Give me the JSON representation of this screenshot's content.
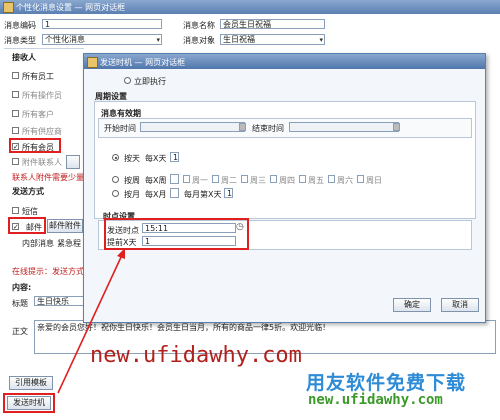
{
  "back_window": {
    "title": "个性化消息设置 — 网页对话框",
    "fields": {
      "code_label": "消息编码",
      "code_value": "1",
      "name_label": "消息名称",
      "name_value": "会员生日祝福",
      "type_label": "消息类型",
      "type_value": "个性化消息",
      "target_label": "消息对象",
      "target_value": "生日祝福"
    },
    "receivers": {
      "section": "接收人",
      "items": [
        "所有员工",
        "所有操作员",
        "所有客户",
        "所有供应商",
        "所有会员",
        "附件联系人"
      ],
      "checked": [
        false,
        false,
        false,
        false,
        true,
        false
      ],
      "tip": "联系人附件需要少量"
    },
    "send_method": {
      "section": "发送方式",
      "sms": "短信",
      "mail": "邮件",
      "mail_attach": "邮件附件",
      "internal": "内部消息",
      "urgent": "紧急程",
      "online_tip": "在线提示：发送方式"
    },
    "content": {
      "section": "内容:",
      "subject_label": "标题",
      "subject_value": "生日快乐",
      "body_label": "正文",
      "body_value": "亲爱的会员您好！祝你生日快乐！会员生日当月，所有的商品一律5折。欢迎光临！"
    },
    "buttons": {
      "cite_template": "引用模板",
      "send_timing": "发送时机"
    }
  },
  "dialog": {
    "title": "发送时机 — 网页对话框",
    "immediate": "立即执行",
    "period_section": "周期设置",
    "validity_section": "消息有效期",
    "start_label": "开始时间",
    "end_label": "结束时间",
    "by_day": "按天",
    "every_x_day": "每X天",
    "by_week": "按周",
    "every_x_week": "每X周",
    "weekdays": [
      "周一",
      "周二",
      "周三",
      "周四",
      "周五",
      "周六",
      "周日"
    ],
    "by_month": "按月",
    "every_x_month": "每X月",
    "every_month_x_day": "每月第X天",
    "day_value": "1",
    "month_day_value": "1",
    "time_section": "时点设置",
    "send_time_label": "发送时点",
    "send_time_value": "15:11",
    "advance_label": "提前X天",
    "advance_value": "1",
    "ok": "确定",
    "cancel": "取消"
  },
  "watermark": {
    "url": "new.ufidawhy.com",
    "brand": "用友软件免费下载",
    "brand_url": "new.ufidawhy.com"
  },
  "colors": {
    "annotation_red": "#e02020",
    "title_blue": "#5a7fb2",
    "watermark_red": "#b0201c",
    "watermark_blue": "#2e8bd6",
    "watermark_green": "#3c9a2a"
  }
}
